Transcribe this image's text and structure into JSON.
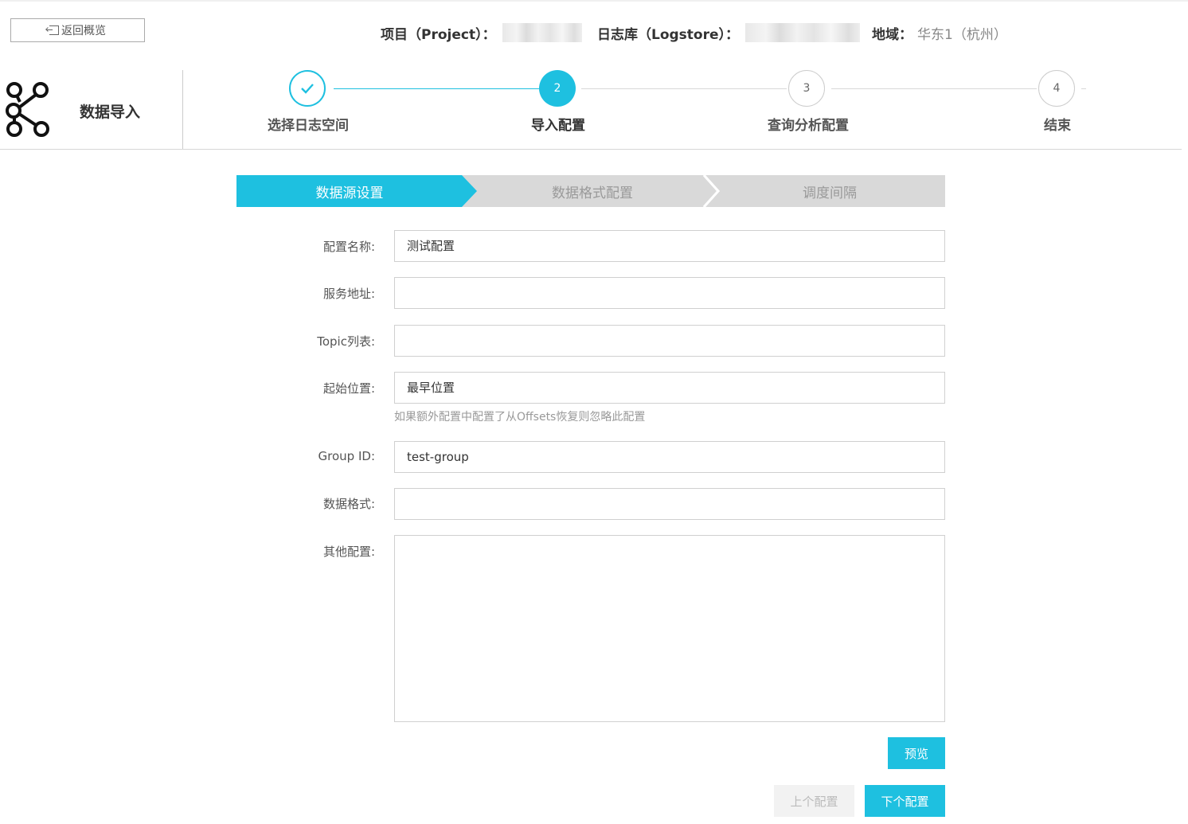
{
  "header": {
    "back_label": "返回概览",
    "project_label": "项目（Project）：",
    "logstore_label": "日志库（Logstore）：",
    "region_label": "地域：",
    "region_value": "华东1（杭州）"
  },
  "brand": {
    "title": "数据导入"
  },
  "steps": [
    {
      "number": "1",
      "label": "选择日志空间",
      "state": "done"
    },
    {
      "number": "2",
      "label": "导入配置",
      "state": "active"
    },
    {
      "number": "3",
      "label": "查询分析配置",
      "state": "todo"
    },
    {
      "number": "4",
      "label": "结束",
      "state": "todo"
    }
  ],
  "wizard_tabs": [
    "数据源设置",
    "数据格式配置",
    "调度间隔"
  ],
  "form": {
    "config_name": {
      "label": "配置名称:",
      "value": "测试配置"
    },
    "service_addr": {
      "label": "服务地址:",
      "value": ""
    },
    "topic_list": {
      "label": "Topic列表:",
      "value": ""
    },
    "start_pos": {
      "label": "起始位置:",
      "value": "最早位置",
      "help": "如果额外配置中配置了从Offsets恢复则忽略此配置"
    },
    "group_id": {
      "label": "Group ID:",
      "value": "test-group"
    },
    "data_format": {
      "label": "数据格式:",
      "value": ""
    },
    "other_config": {
      "label": "其他配置:",
      "value": ""
    }
  },
  "buttons": {
    "preview": "预览",
    "prev": "上个配置",
    "next": "下个配置"
  },
  "colors": {
    "accent": "#1ec0e0"
  }
}
